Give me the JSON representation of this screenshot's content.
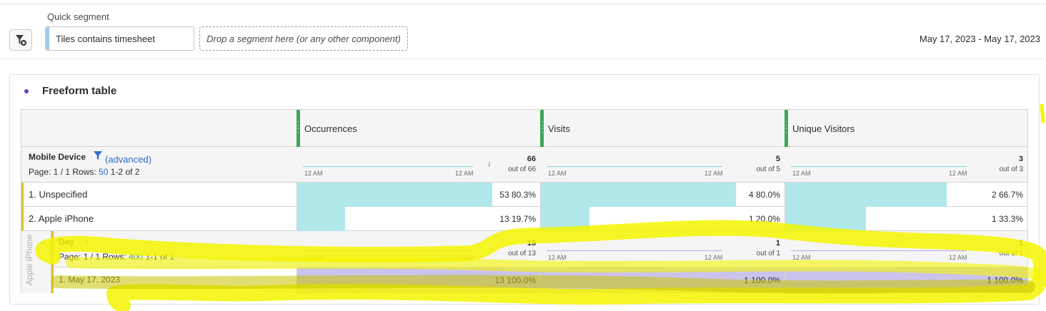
{
  "segment_bar": {
    "label": "Quick segment",
    "filter_button_icon": "filter-add-icon",
    "segment_chip": "Tiles contains timesheet",
    "drop_placeholder": "Drop a segment here (or any other component)",
    "date_range": "May 17, 2023 - May 17, 2023"
  },
  "panel": {
    "title": "Freeform table",
    "dot_color": "#6e3fb7"
  },
  "table": {
    "metrics": [
      {
        "name": "Occurrences",
        "total": "66",
        "out_of": "out of 66",
        "spark_left": "12 AM",
        "spark_right": "12 AM"
      },
      {
        "name": "Visits",
        "total": "5",
        "out_of": "out of 5",
        "spark_left": "12 AM",
        "spark_right": "12 AM"
      },
      {
        "name": "Unique Visitors",
        "total": "3",
        "out_of": "out of 3",
        "spark_left": "12 AM",
        "spark_right": "12 AM"
      }
    ],
    "dimension": {
      "name": "Mobile Device",
      "advanced": "(advanced)",
      "page_prefix": "Page: 1 / 1 Rows:",
      "rows_count": "50",
      "range": "1-2 of 2"
    },
    "sort_icon": "sort-down-icon",
    "rows": [
      {
        "label": "1.  Unspecified",
        "cells": [
          {
            "value": "53  80.3%",
            "pct": 0.803
          },
          {
            "value": "4  80.0%",
            "pct": 0.8
          },
          {
            "value": "2  66.7%",
            "pct": 0.667
          }
        ]
      },
      {
        "label": "2.  Apple iPhone",
        "cells": [
          {
            "value": "13  19.7%",
            "pct": 0.197
          },
          {
            "value": "1  20.0%",
            "pct": 0.2
          },
          {
            "value": "1  33.3%",
            "pct": 0.333
          }
        ]
      }
    ],
    "breakdown": {
      "parent": "Apple iPhone",
      "dimension": "Day",
      "sort_icon": "sort-up-icon",
      "page_prefix": "Page: 1 / 1 Rows:",
      "rows_count": "400",
      "range": "1-1 of 1",
      "metrics": [
        {
          "total": "13",
          "out_of": "out of 13",
          "spark_left": "12 AM",
          "spark_right": "12 AM"
        },
        {
          "total": "1",
          "out_of": "out of 1",
          "spark_left": "12 AM",
          "spark_right": "12 AM"
        },
        {
          "total": "1",
          "out_of": "out of 1",
          "spark_left": "12 AM",
          "spark_right": "12 AM"
        }
      ],
      "rows": [
        {
          "label": "1.  May 17, 2023",
          "cells": [
            {
              "value": "13  100.0%",
              "pct": 1.0
            },
            {
              "value": "1  100.0%",
              "pct": 1.0
            },
            {
              "value": "1  100.0%",
              "pct": 1.0
            }
          ]
        }
      ]
    }
  },
  "colors": {
    "accent_bar": "#b1e8ea",
    "breakdown_bar": "#cbc3ec",
    "metric_marker": "#3ea55a",
    "row_accent": "#e0be2e",
    "highlight": "#f5f500"
  }
}
